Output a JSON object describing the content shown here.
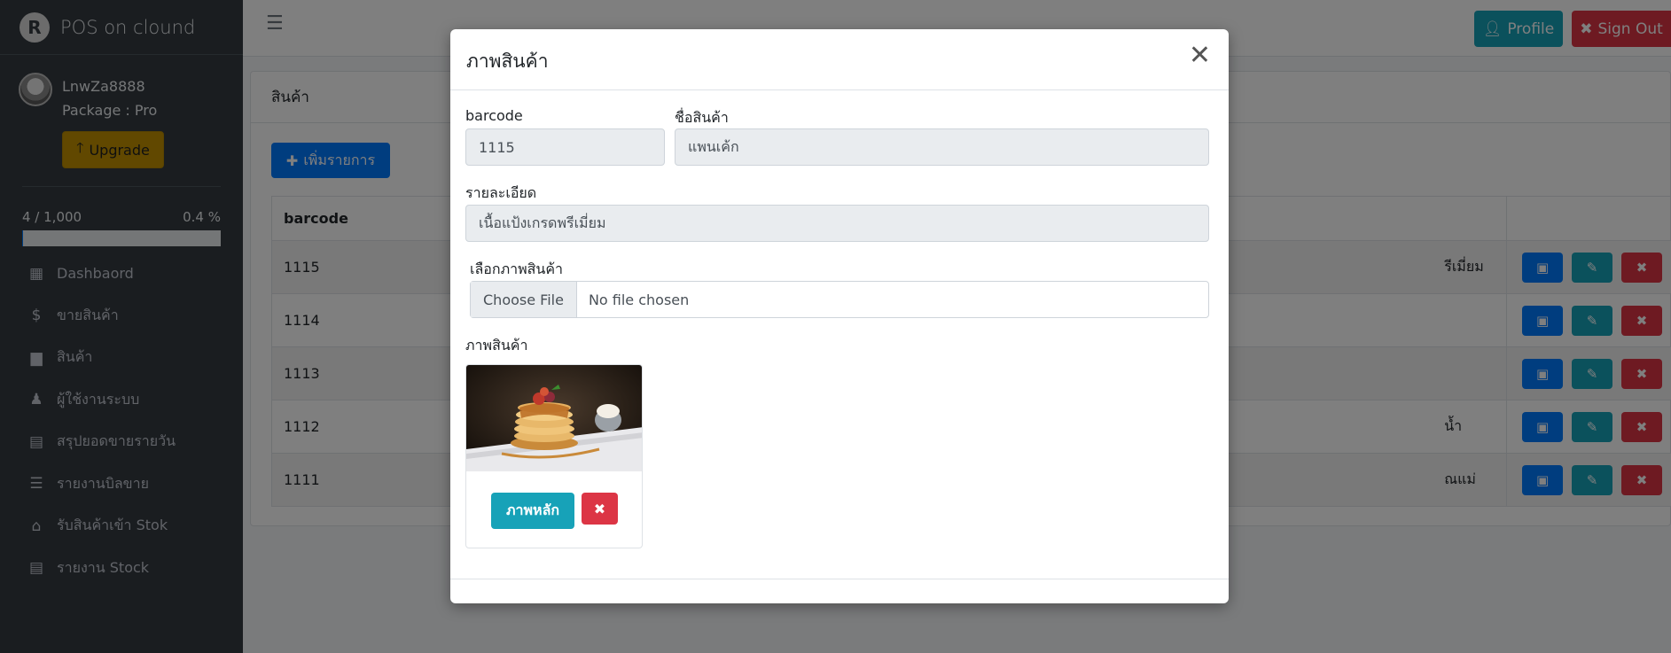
{
  "app": {
    "brand": "POS on clound",
    "logo_letter": "R"
  },
  "user": {
    "name": "LnwZa8888",
    "package": "Package : Pro",
    "upgrade_label": "Upgrade"
  },
  "usage": {
    "count": "4 / 1,000",
    "percent": "0.4 %",
    "fraction": 0.004
  },
  "nav": [
    {
      "label": "Dashbaord",
      "icon": "grid-icon",
      "glyph": "▦"
    },
    {
      "label": "ขายสินค้า",
      "icon": "dollar-icon",
      "glyph": "$"
    },
    {
      "label": "สินค้า",
      "icon": "box-icon",
      "glyph": "▆"
    },
    {
      "label": "ผู้ใช้งานระบบ",
      "icon": "person-icon",
      "glyph": "♟"
    },
    {
      "label": "สรุปยอดขายรายวัน",
      "icon": "file-icon",
      "glyph": "▤"
    },
    {
      "label": "รายงานบิลขาย",
      "icon": "list-icon",
      "glyph": "☰"
    },
    {
      "label": "รับสินค้าเข้า Stok",
      "icon": "home-icon",
      "glyph": "⌂"
    },
    {
      "label": "รายงาน Stock",
      "icon": "file-icon",
      "glyph": "▤"
    }
  ],
  "topbar": {
    "profile_label": "Profile",
    "signout_label": "Sign Out"
  },
  "page": {
    "title": "สินค้า",
    "add_label": "เพิ่มรายการ"
  },
  "table": {
    "header_barcode": "barcode",
    "rows": [
      {
        "barcode": "1115",
        "detail": "รีเมี่ยม"
      },
      {
        "barcode": "1114",
        "detail": ""
      },
      {
        "barcode": "1113",
        "detail": ""
      },
      {
        "barcode": "1112",
        "detail": "น้ำ"
      },
      {
        "barcode": "1111",
        "detail": "ณแม่"
      }
    ]
  },
  "modal": {
    "title": "ภาพสินค้า",
    "barcode_label": "barcode",
    "barcode_value": "1115",
    "name_label": "ชื่อสินค้า",
    "name_value": "แพนเค้ก",
    "detail_label": "รายละเอียด",
    "detail_value": "เนื้อแป้งเกรดพรีเมี่ยม",
    "choose_label": "เลือกภาพสินค้า",
    "file_button": "Choose File",
    "file_status": "No file chosen",
    "image_label": "ภาพสินค้า",
    "main_image_label": "ภาพหลัก"
  },
  "colors": {
    "primary": "#007bff",
    "info": "#17a2b8",
    "danger": "#dc3545",
    "warning": "#c29100",
    "sidebar": "#343a40"
  }
}
